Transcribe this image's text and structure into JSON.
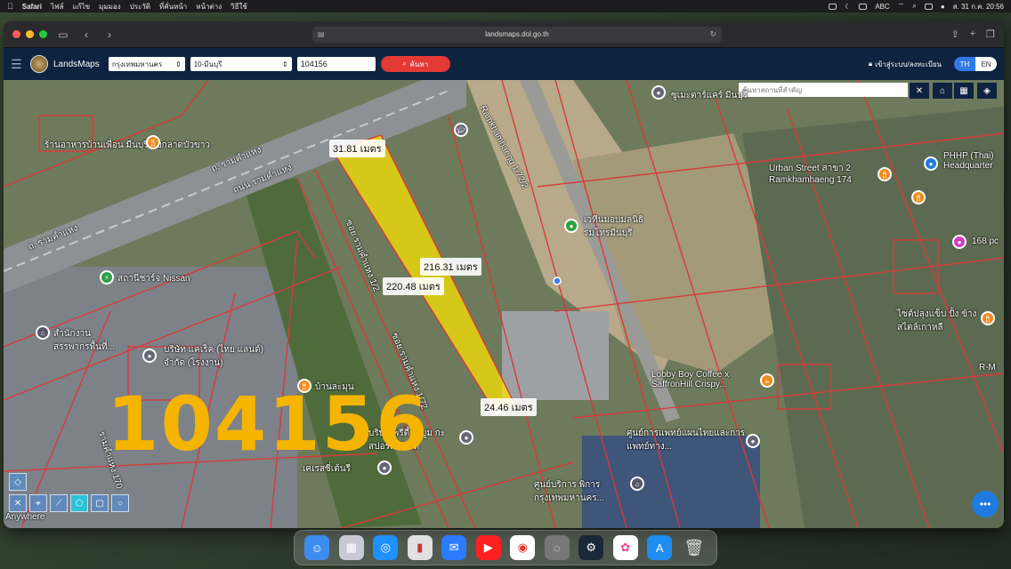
{
  "menubar": {
    "apple": "",
    "app_name": "Safari",
    "items": [
      "ไฟล์",
      "แก้ไข",
      "มุมมอง",
      "ประวัติ",
      "ที่คั่นหน้า",
      "หน้าต่าง",
      "วิธีใช้"
    ],
    "input_source": "ABC",
    "clock": "ส. 31 ก.ค. 20:56"
  },
  "browser": {
    "url": "landsmaps.dol.go.th"
  },
  "app": {
    "title": "LandsMaps",
    "province": "กรุงเทพมหานคร",
    "district": "10-มีนบุรี",
    "parcel_input": "104156",
    "search_label": "ค้นหา",
    "login_label": "เข้าสู่ระบบ/ลงทะเบียน",
    "lang_th": "TH",
    "lang_en": "EN"
  },
  "map": {
    "place_search_placeholder": "ค้นหาสถานที่สำคัญ",
    "measurements": {
      "top": "31.81 เมตร",
      "right": "216.31 เมตร",
      "left": "220.48 เมตร",
      "bottom": "24.46 เมตร"
    },
    "parcel_number": "104156",
    "labels": {
      "restaurant": "ร้านอาหารบ้านเพื่อน มีนบุรี แยกลาดบัวขาว",
      "road1": "ถ. รามคำแหง",
      "road2": "ถนน รามคำแหง",
      "road3": "ถ. รามคำแหง",
      "charger": "สถานีชาร์จ Nissan",
      "office": "สำนักงาน สรรพากรพื้นที่...",
      "company": "บริษัท แคเร็ค (ไทย แลนด์) จำกัด (โรงงาน)",
      "banlamun": "บ้านละมุน",
      "soi1": "ซอย รามคำแหง 1/2",
      "soi2": "ซอย รามคำแหง 1/72",
      "ramkhamhaeng": "Ramkhamhaeng 1/72/2",
      "supermarket": "ซูเมะตาร์แคร์ มีนบุรี",
      "church": "เวทีนมอบมลนิธิ รมโทรมีนบุรี",
      "urban_street": "Urban Street สาขา 2 Ramkhamhaeng 174",
      "phhp": "PHHP (Thai) Headquarter",
      "shop168": "168 pc",
      "lobby": "Lobby Boy Coffee x SaffronHill Crispy...",
      "medical": "ศูนย์การแพทย์แผนไทยและการแพทย์ทาง...",
      "center": "ศูนย์บริการ พิการกรุงเทพมหานคร...",
      "pretty": "บริษัท พรีตี้ ไวยูม กะ สปอร์ต จำกัด",
      "glass": "เคเรสซี่เต้นรี",
      "rm": "R-M",
      "soi170": "รามคำแหง 170",
      "anywhere": "Anywhere",
      "shop": "ไซต์ปลุงแข็บ ปั้ง ข้างสไตล์เกาหลี"
    }
  },
  "dock": {
    "apps": [
      "finder-icon",
      "launchpad-icon",
      "safari-icon",
      "notes-icon",
      "messenger-icon",
      "youtube-icon",
      "music-icon",
      "disk-icon",
      "steam-icon",
      "photos-icon",
      "appstore-icon",
      "trash-icon"
    ]
  },
  "colors": {
    "parcel_fill": "#ffe600",
    "parcel_lines": "#d83a3a",
    "header_bg": "#0e2340",
    "search_btn": "#e53935",
    "number_color": "#f4b400"
  }
}
